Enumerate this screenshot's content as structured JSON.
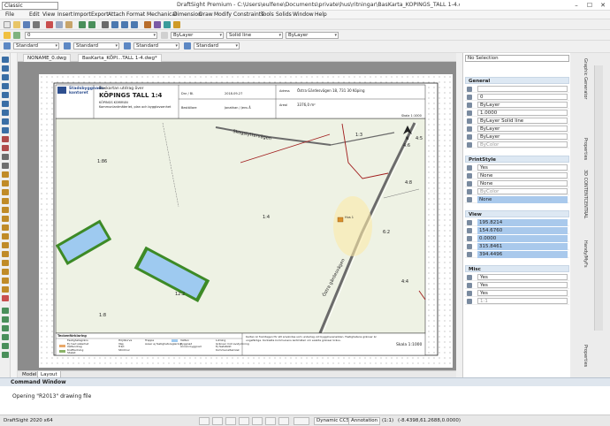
{
  "window": {
    "workspace": "Classic",
    "title": "DraftSight Premium - C:\\Users\\eulfene\\Documents\\private\\hus\\ritningar\\BasKarta_KÖPINGS_TALL 1-4.dwg",
    "controls": [
      "–",
      "☐",
      "✕"
    ]
  },
  "menu": [
    "File",
    "Edit",
    "View",
    "Insert",
    "Import",
    "Export",
    "Attach",
    "Format",
    "Mechanical",
    "Dimension",
    "Draw",
    "Modify",
    "Constraints",
    "Tools",
    "Solids",
    "Window",
    "Help"
  ],
  "toolbar2": {
    "layer": "0",
    "color": "ByLayer",
    "linestyle": "Solid line",
    "lineweight": "ByLayer"
  },
  "toolbar3": {
    "style1": "Standard",
    "style2": "Standard",
    "style3": "Standard",
    "style4": "Standard"
  },
  "doc_tabs": [
    "NONAME_0.dwg",
    "BasKarta_KÖPI...TALL 1-4.dwg*"
  ],
  "layout_tabs": [
    "Model",
    "Layout"
  ],
  "map": {
    "org1": "Stadsbyggnads-",
    "org2": "kontoret",
    "basemap": "Baskartan utdrag över",
    "property": "KÖPINGS TALL 1:4",
    "muni": "KÖPINGS KOMMUN",
    "sub": "Kommunlantmäteriet, plan och bygglovsenhet",
    "date_label": "Dnr / Bl.",
    "date": "2018-09-27",
    "sheet_label": "Beställare",
    "orderer": "Jonathan / Jens Å",
    "address_label": "Adress",
    "address": "Östra Gärdesvägen 18, 731 30 Köping",
    "area_label": "Areal",
    "area": "3376,0 m²",
    "scale_top": "Skala 1:1000",
    "lbl_road1": "Skogstyttervägen",
    "lbl_road2": "Östra gärdesvägen",
    "lbl_13": "1:3",
    "lbl_45": "4:5",
    "lbl_46": "4:6",
    "lbl_48": "4:8",
    "lbl_186": "1:86",
    "lbl_14": "1:4",
    "lbl_12": "12:2",
    "lbl_18": "1:8",
    "lbl_44": "4:4",
    "lbl_62": "6:2",
    "house": "Hus 1",
    "north": "N",
    "legend_title": "Teckenförklaring",
    "legend_items": [
      "Fastighetsgräns",
      "Ej med säkerhet",
      "Vattendrag",
      "Kraftledning",
      "Staket",
      "Kommunalteknisk"
    ],
    "legend_2": [
      "Höjdkurva",
      "Väg",
      "Träd",
      "Stödmur",
      "Trappa",
      "Vatten"
    ],
    "legend_3": [
      "Byggnad",
      "Annan byggnad",
      "Lutning"
    ],
    "legend_4": [
      "Avser ej fastighetsreglering",
      "Gränser mot avstyckning",
      "Ej fastställd"
    ],
    "note": "Kartan är framtagen för att användas som underlag vid bygglovsansökan. Fastighetens gränser är ungefärliga. Kontakta kommunens lantmäteri om exakta gränser krävs.",
    "scale_bottom": "Skala 1:1000"
  },
  "props": {
    "selection": "No Selection",
    "general_title": "General",
    "general": [
      "",
      "0",
      "ByLayer",
      "1.0000",
      "ByLayer    Solid line",
      "ByLayer",
      "ByLayer",
      "ByColor"
    ],
    "printstyle_title": "PrintStyle",
    "printstyle": [
      "Yes",
      "None",
      "None",
      "ByColor",
      "None"
    ],
    "view_title": "View",
    "view": [
      "195.8214",
      "154.6760",
      "0.0000",
      "315.8461",
      "394.4496"
    ],
    "misc_title": "Misc",
    "misc": [
      "Yes",
      "Yes",
      "Yes",
      "1:1"
    ]
  },
  "side_tabs": [
    "Graphic Generator",
    "Properties",
    "3D CONTENTCENTRAL",
    "Handy/MyFs",
    "Properties"
  ],
  "command": {
    "title": "Command Window",
    "line": "Opening \"R2013\" drawing file"
  },
  "status": {
    "app": "DraftSight 2020 x64",
    "dynamic": "Dynamic CCS",
    "annotation": "Annotation",
    "scale": "(1:1)",
    "coords": "(-8.4398,61.2688,0.0000)"
  },
  "colors": {
    "map_fill": "#eef2e4",
    "water": "#9ecaf0",
    "water_border": "#3d8a26",
    "road": "#6b6b6b",
    "property_line": "#a01c1c",
    "highlight": "#fce9a8",
    "panel_header": "#dde8f3",
    "selected_value": "#a9c9ec"
  }
}
